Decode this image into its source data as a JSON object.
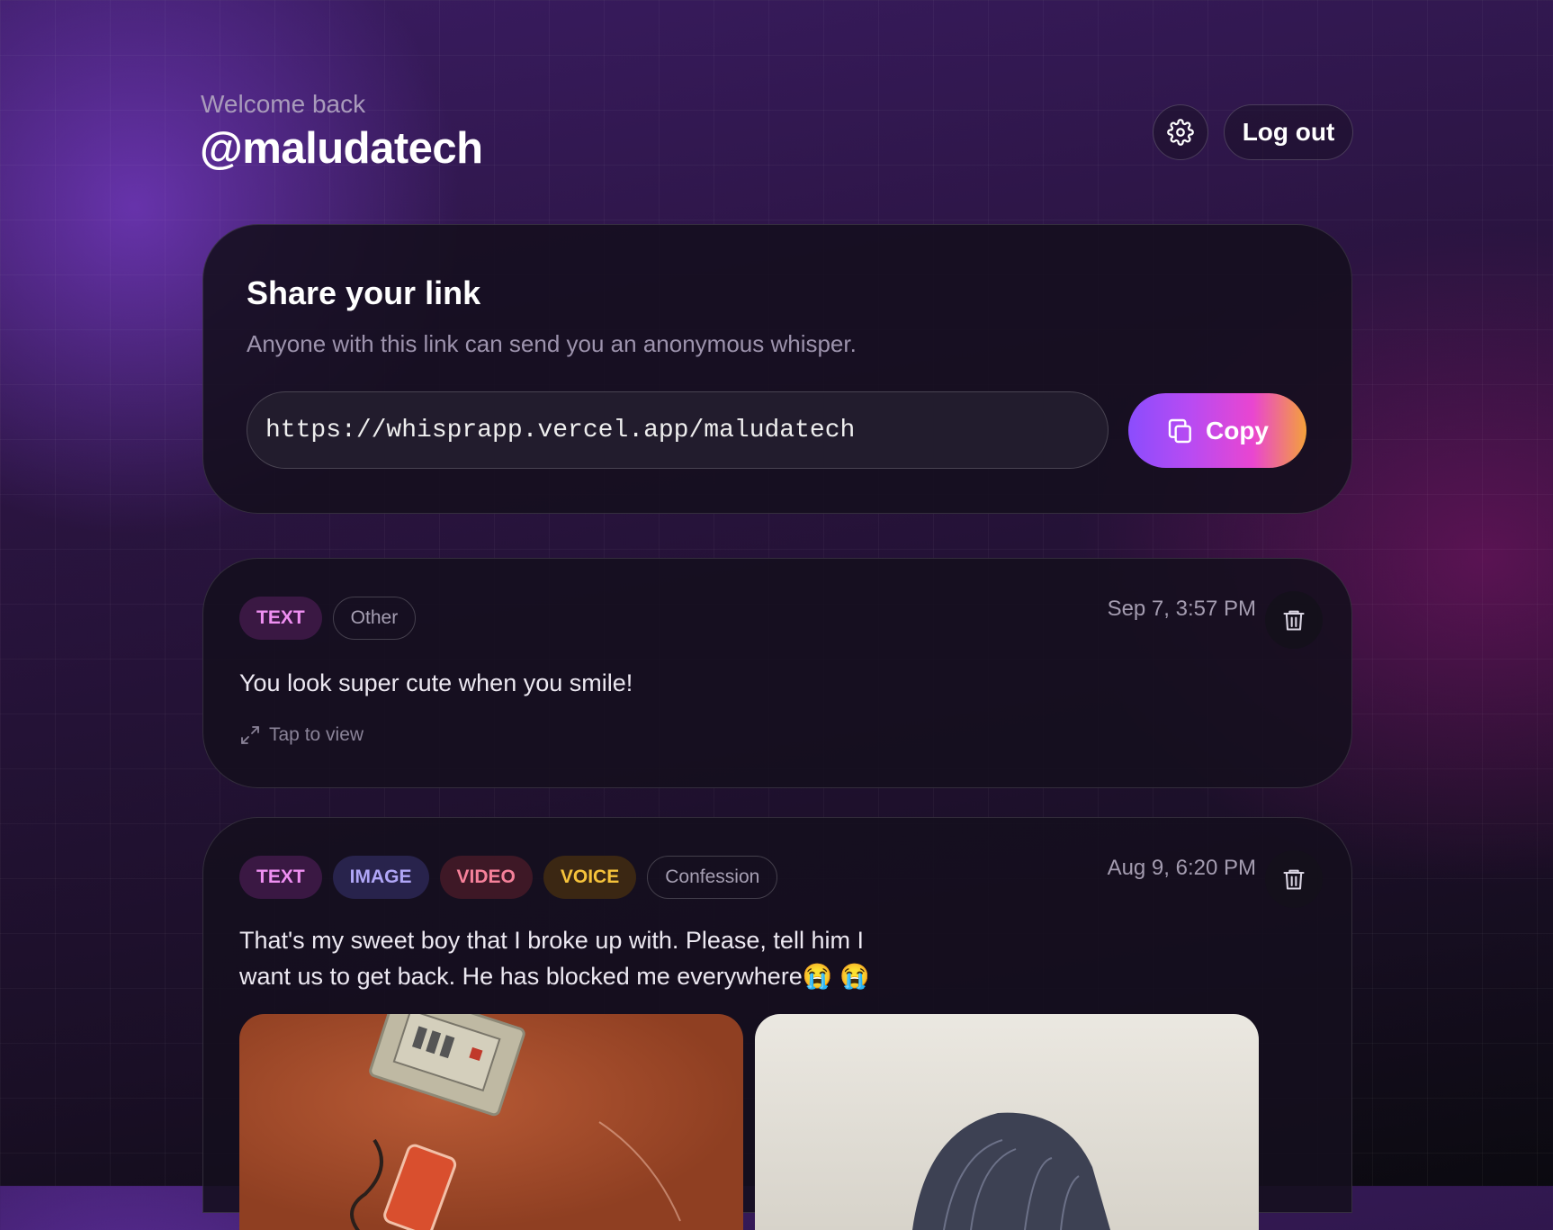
{
  "header": {
    "greeting": "Welcome back",
    "username": "@maludatech",
    "settings_icon": "gear-icon",
    "logout_label": "Log out"
  },
  "share": {
    "title": "Share your link",
    "subtitle": "Anyone with this link can send you an anonymous whisper.",
    "link": "https://whisprapp.vercel.app/maludatech",
    "copy_label": "Copy",
    "copy_icon": "copy-icon",
    "copy_gradient": [
      "#8b4dfd",
      "#e946d0",
      "#f4a13a"
    ]
  },
  "messages": [
    {
      "tags": [
        "TEXT"
      ],
      "category": "Other",
      "time": "Sep 7, 3:57 PM",
      "body": "You look super cute when you smile!",
      "tap_label": "Tap to view"
    },
    {
      "tags": [
        "TEXT",
        "IMAGE",
        "VIDEO",
        "VOICE"
      ],
      "category": "Confession",
      "time": "Aug 9, 6:20 PM",
      "body_line1": "That's my sweet boy that I broke up with. Please, tell him I",
      "body_line2": "want us to get back. He has blocked me everywhere",
      "emoji": "😭 😭"
    }
  ],
  "colors": {
    "tag_text": "#ef8ff2",
    "tag_image": "#b0a6f7",
    "tag_video": "#f6819a",
    "tag_voice": "#f6c33b"
  }
}
